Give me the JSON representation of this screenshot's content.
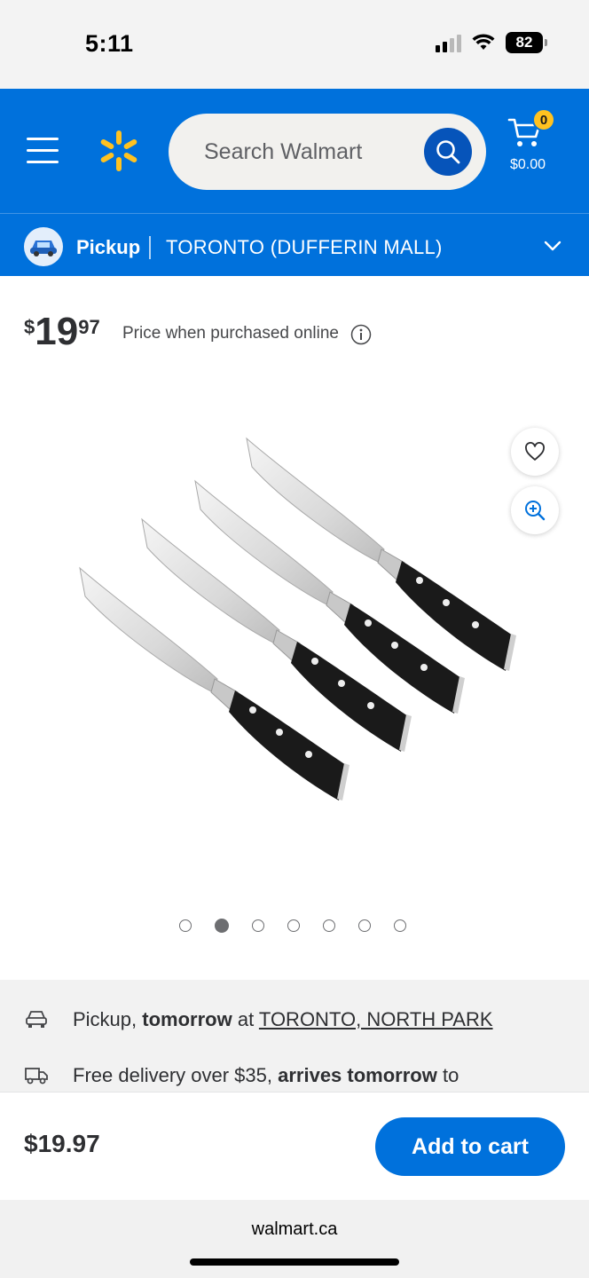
{
  "status_bar": {
    "time": "5:11",
    "battery": "82"
  },
  "header": {
    "search": {
      "placeholder": "Search Walmart"
    },
    "cart": {
      "count": "0",
      "total": "$0.00"
    }
  },
  "pickup_bar": {
    "mode": "Pickup",
    "store": "TORONTO (DUFFERIN MALL)"
  },
  "product": {
    "price_currency": "$",
    "price_dollars": "19",
    "price_cents": "97",
    "price_note": "Price when purchased online",
    "image_count": 7,
    "active_image_index": 1
  },
  "fulfillment": {
    "pickup": {
      "prefix": "Pickup, ",
      "bold": "tomorrow",
      "middle": " at ",
      "link": "TORONTO, NORTH PARK"
    },
    "delivery": {
      "prefix": "Free delivery over $35, ",
      "bold": "arrives tomorrow",
      "suffix": " to"
    }
  },
  "action_bar": {
    "price": "$19.97",
    "add_to_cart_label": "Add to cart"
  },
  "browser": {
    "url": "walmart.ca"
  },
  "colors": {
    "brand_blue": "#0071dc",
    "spark_yellow": "#ffc220",
    "search_button": "#0654ba"
  }
}
